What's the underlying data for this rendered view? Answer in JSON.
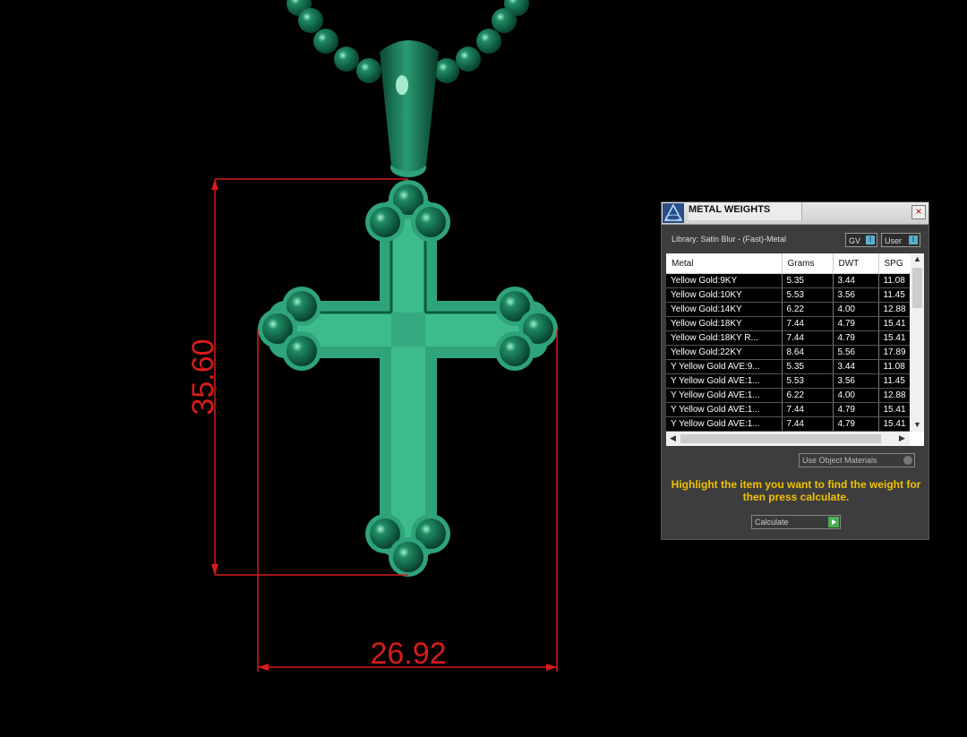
{
  "dimensions": {
    "height_label": "35.60",
    "width_label": "26.92",
    "line_color": "#d81b1b"
  },
  "model": {
    "color": "#2fa37a"
  },
  "panel": {
    "title": "METAL WEIGHTS",
    "close_glyph": "×",
    "library": "Library: Satin Blur - (Fast)-Metal",
    "toggle_gv": "GV",
    "toggle_user": "User",
    "columns": [
      "Metal",
      "Grams",
      "DWT",
      "SPG"
    ],
    "rows": [
      [
        "Yellow Gold:9KY",
        "5.35",
        "3.44",
        "11.08"
      ],
      [
        "Yellow Gold:10KY",
        "5.53",
        "3.56",
        "11.45"
      ],
      [
        "Yellow Gold:14KY",
        "6.22",
        "4.00",
        "12.88"
      ],
      [
        "Yellow Gold:18KY",
        "7.44",
        "4.79",
        "15.41"
      ],
      [
        "Yellow Gold:18KY R...",
        "7.44",
        "4.79",
        "15.41"
      ],
      [
        "Yellow Gold:22KY",
        "8.64",
        "5.56",
        "17.89"
      ],
      [
        "Y Yellow Gold AVE:9...",
        "5.35",
        "3.44",
        "11.08"
      ],
      [
        "Y Yellow Gold AVE:1...",
        "5.53",
        "3.56",
        "11.45"
      ],
      [
        "Y Yellow Gold AVE:1...",
        "6.22",
        "4.00",
        "12.88"
      ],
      [
        "Y Yellow Gold AVE:1...",
        "7.44",
        "4.79",
        "15.41"
      ],
      [
        "Y Yellow Gold AVE:1...",
        "7.44",
        "4.79",
        "15.41"
      ]
    ],
    "use_object_materials": "Use Object Materials",
    "hint": "Highlight the item you want to find the weight for then press calculate.",
    "calculate_label": "Calculate"
  }
}
